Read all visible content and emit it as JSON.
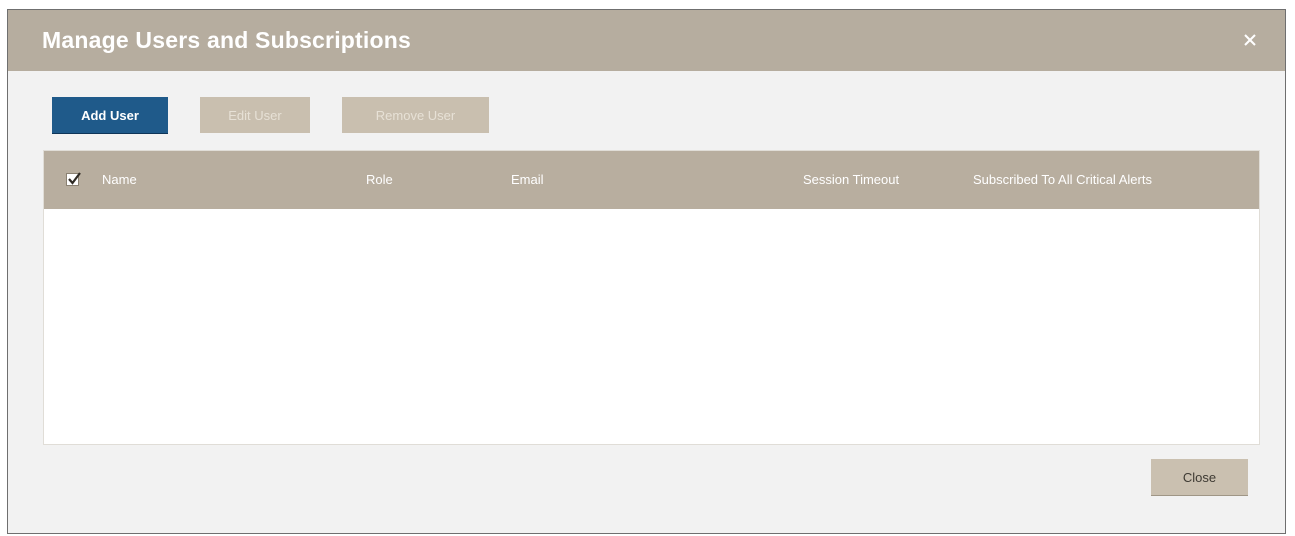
{
  "dialog": {
    "title": "Manage Users and Subscriptions",
    "close_icon": "close-icon"
  },
  "toolbar": {
    "add_user_label": "Add User",
    "edit_user_label": "Edit User",
    "remove_user_label": "Remove User"
  },
  "table": {
    "select_all_checked": true,
    "columns": [
      {
        "label": "Name"
      },
      {
        "label": "Role"
      },
      {
        "label": "Email"
      },
      {
        "label": "Session Timeout"
      },
      {
        "label": "Subscribed To All Critical Alerts"
      }
    ],
    "rows": []
  },
  "footer": {
    "close_label": "Close"
  },
  "colors": {
    "titlebar": "#b6ad9f",
    "primary_button": "#1f5a8a",
    "disabled_button": "#c9bfaf",
    "table_header": "#b8ae9f",
    "dialog_bg": "#f2f2f2"
  }
}
